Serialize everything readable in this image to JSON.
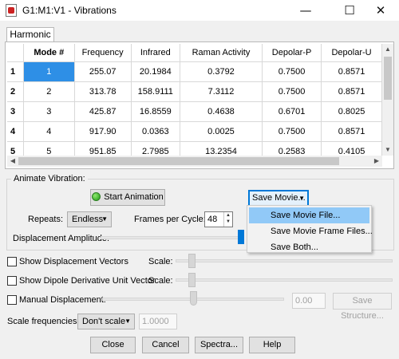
{
  "window": {
    "title": "G1:M1:V1 - Vibrations",
    "app_icon": "document-icon",
    "controls": [
      "minimize-icon",
      "maximize-icon",
      "close-icon"
    ]
  },
  "tabs": [
    {
      "label": "Harmonic",
      "active": true
    }
  ],
  "table": {
    "columns": [
      "Mode #",
      "Frequency",
      "Infrared",
      "Raman Activity",
      "Depolar-P",
      "Depolar-U"
    ],
    "rows": [
      {
        "index": "1",
        "mode": "1",
        "frequency": "255.07",
        "infrared": "20.1984",
        "raman": "0.3792",
        "depolar_p": "0.7500",
        "depolar_u": "0.8571"
      },
      {
        "index": "2",
        "mode": "2",
        "frequency": "313.78",
        "infrared": "158.9111",
        "raman": "7.3112",
        "depolar_p": "0.7500",
        "depolar_u": "0.8571"
      },
      {
        "index": "3",
        "mode": "3",
        "frequency": "425.87",
        "infrared": "16.8559",
        "raman": "0.4638",
        "depolar_p": "0.6701",
        "depolar_u": "0.8025"
      },
      {
        "index": "4",
        "mode": "4",
        "frequency": "917.90",
        "infrared": "0.0363",
        "raman": "0.0025",
        "depolar_p": "0.7500",
        "depolar_u": "0.8571"
      },
      {
        "index": "5",
        "mode": "5",
        "frequency": "951.85",
        "infrared": "2.7985",
        "raman": "13.2354",
        "depolar_p": "0.2583",
        "depolar_u": "0.4105"
      }
    ],
    "selected_row": 1
  },
  "animate": {
    "group_label": "Animate Vibration:",
    "start_button": "Start Animation",
    "save_movie_button": "Save Movie...",
    "repeats_label": "Repeats:",
    "repeats_value": "Endless",
    "fps_label": "Frames per Cycle:",
    "fps_value": "48",
    "displacement_label": "Displacement Amplitude:"
  },
  "save_menu": {
    "items": [
      "Save Movie File...",
      "Save Movie Frame Files...",
      "Save Both..."
    ],
    "highlighted": 0
  },
  "options": {
    "show_displacement_vectors": "Show Displacement Vectors",
    "show_dipole_vector": "Show Dipole Derivative Unit Vector",
    "manual_displacement": "Manual Displacement:",
    "scale_label": "Scale:",
    "manual_value": "0.00",
    "save_structure_button": "Save Structure..."
  },
  "scale_freq": {
    "label": "Scale frequencies?",
    "value": "Don't scale",
    "factor": "1.0000"
  },
  "footer": {
    "close": "Close",
    "cancel": "Cancel",
    "spectra": "Spectra...",
    "help": "Help"
  }
}
